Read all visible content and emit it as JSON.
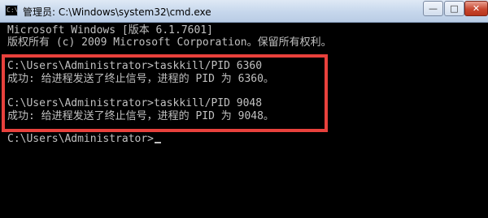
{
  "window": {
    "title": "管理员: C:\\Windows\\system32\\cmd.exe",
    "icon": "console-icon",
    "icon_glyph": "C:\\",
    "min_glyph": "—",
    "max_glyph": "□",
    "close_glyph": "✕"
  },
  "console": {
    "lines": [
      "Microsoft Windows [版本 6.1.7601]",
      "版权所有 (c) 2009 Microsoft Corporation。保留所有权利。",
      "C:\\Users\\Administrator>taskkill/PID 6360",
      "成功: 给进程发送了终止信号，进程的 PID 为 6360。",
      "C:\\Users\\Administrator>taskkill/PID 9048",
      "成功: 给进程发送了终止信号，进程的 PID 为 9048。",
      "C:\\Users\\Administrator>"
    ]
  },
  "colors": {
    "console_bg": "#000000",
    "console_text": "#c0c0c0",
    "highlight_border": "#e8413c",
    "close_button": "#c8472f"
  }
}
